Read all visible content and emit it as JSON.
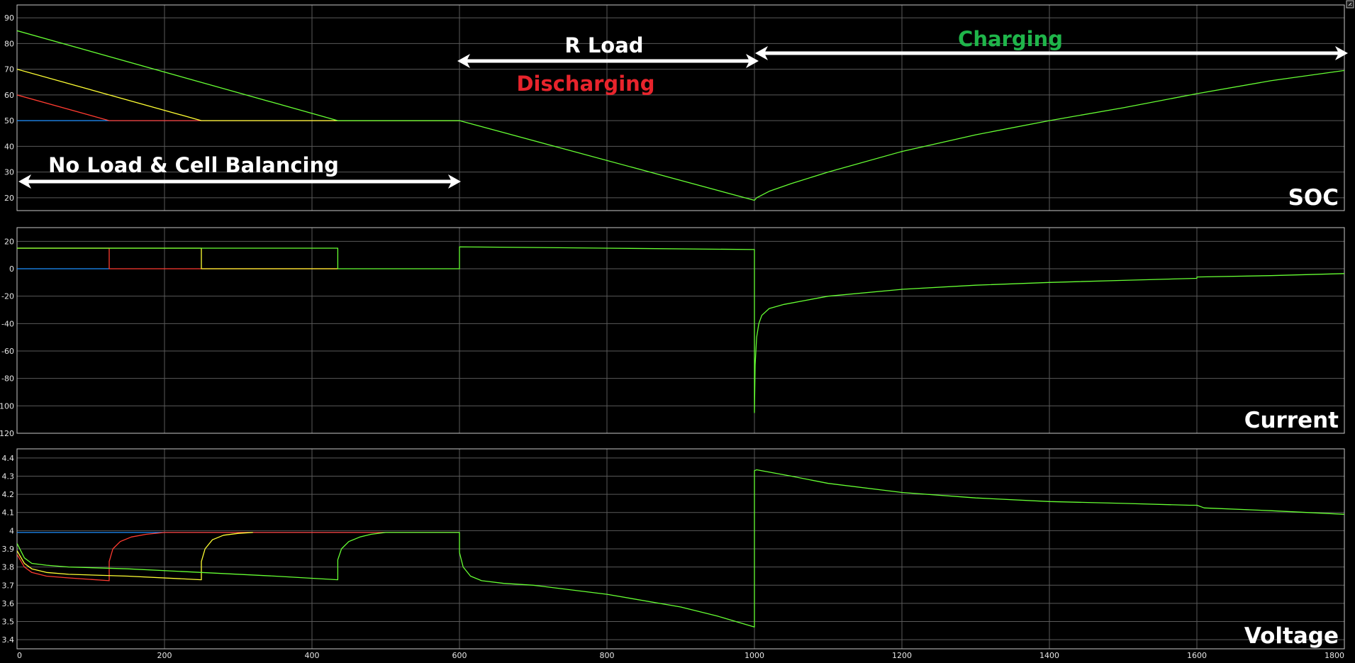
{
  "scope": {
    "background": "#000000",
    "axes_color": "#c8c8c8",
    "grid_color": "#5a5a5a",
    "text_color": "#ffffff",
    "corner_icon": "resize-handle-icon"
  },
  "chart_data": [
    {
      "type": "line",
      "panel_label": "SOC",
      "xlim": [
        0,
        1800
      ],
      "ylim": [
        15,
        95
      ],
      "yticks": [
        20,
        30,
        40,
        50,
        60,
        70,
        80,
        90
      ],
      "xticks": [
        0,
        200,
        400,
        600,
        800,
        1000,
        1200,
        1400,
        1600,
        1800
      ],
      "show_xtick_labels": false,
      "grid": true,
      "series": [
        {
          "color": "#1e90ff",
          "x": [
            0,
            600
          ],
          "y": [
            50,
            50
          ]
        },
        {
          "color": "#ff3b30",
          "x": [
            0,
            125,
            600
          ],
          "y": [
            60,
            50,
            50
          ]
        },
        {
          "color": "#ffff33",
          "x": [
            0,
            250,
            600
          ],
          "y": [
            70,
            50,
            50
          ]
        },
        {
          "color": "#66ff33",
          "x": [
            0,
            435,
            600,
            1000,
            1003,
            1020,
            1050,
            1100,
            1200,
            1300,
            1400,
            1500,
            1600,
            1700,
            1800
          ],
          "y": [
            85,
            50,
            50,
            19,
            20,
            22.5,
            25.5,
            30,
            38,
            44.5,
            50,
            55,
            60.5,
            65.5,
            69.5
          ]
        }
      ],
      "annotations": [
        {
          "text": "No Load & Cell Balancing",
          "color": "#ffffff",
          "arrow_from_x": 0,
          "arrow_to_x": 600,
          "y": 21
        },
        {
          "text": "R Load",
          "color": "#ffffff",
          "arrow_from_x": 600,
          "arrow_to_x": 1000,
          "y": 71
        },
        {
          "text": "Discharging",
          "color": "#e8242c"
        },
        {
          "text": "Charging",
          "color": "#1fb54a",
          "arrow_from_x": 1000,
          "arrow_to_x": 1800,
          "y": 74
        }
      ]
    },
    {
      "type": "line",
      "panel_label": "Current",
      "xlim": [
        0,
        1800
      ],
      "ylim": [
        -120,
        30
      ],
      "yticks": [
        20,
        0,
        -20,
        -40,
        -60,
        -80,
        -100,
        -120
      ],
      "xticks": [
        0,
        200,
        400,
        600,
        800,
        1000,
        1200,
        1400,
        1600,
        1800
      ],
      "show_xtick_labels": false,
      "grid": true,
      "series": [
        {
          "color": "#1e90ff",
          "x": [
            0,
            125
          ],
          "y": [
            0,
            0
          ]
        },
        {
          "color": "#ff3b30",
          "x": [
            0,
            125,
            125,
            435
          ],
          "y": [
            15,
            15,
            0,
            0
          ]
        },
        {
          "color": "#ffff33",
          "x": [
            0,
            210,
            250,
            250,
            435
          ],
          "y": [
            15,
            15,
            15,
            0,
            0
          ]
        },
        {
          "color": "#66ff33",
          "x": [
            0,
            435,
            435,
            600,
            600,
            800,
            1000,
            1000,
            1001,
            1003,
            1006,
            1010,
            1020,
            1040,
            1070,
            1100,
            1200,
            1300,
            1400,
            1500,
            1600,
            1600,
            1700,
            1800
          ],
          "y": [
            15,
            15,
            0,
            0,
            16,
            15,
            14,
            -105,
            -70,
            -50,
            -40,
            -34,
            -29,
            -26,
            -23,
            -20,
            -15,
            -12,
            -10,
            -8.5,
            -7,
            -6,
            -5,
            -3.5
          ]
        }
      ]
    },
    {
      "type": "line",
      "panel_label": "Voltage",
      "xlim": [
        0,
        1800
      ],
      "ylim": [
        3.35,
        4.45
      ],
      "yticks": [
        3.4,
        3.5,
        3.6,
        3.7,
        3.8,
        3.9,
        4,
        4.1,
        4.2,
        4.3,
        4.4
      ],
      "xticks": [
        0,
        200,
        400,
        600,
        800,
        1000,
        1200,
        1400,
        1600,
        1800
      ],
      "show_xtick_labels": true,
      "grid": true,
      "series": [
        {
          "color": "#1e90ff",
          "x": [
            0,
            600
          ],
          "y": [
            3.99,
            3.99
          ]
        },
        {
          "color": "#ff3b30",
          "x": [
            0,
            10,
            20,
            40,
            70,
            125,
            125,
            130,
            140,
            155,
            175,
            200,
            600
          ],
          "y": [
            3.87,
            3.8,
            3.77,
            3.75,
            3.74,
            3.725,
            3.83,
            3.9,
            3.94,
            3.965,
            3.98,
            3.99,
            3.99
          ]
        },
        {
          "color": "#ffff33",
          "x": [
            0,
            10,
            20,
            40,
            70,
            150,
            250,
            250,
            255,
            265,
            280,
            300,
            320
          ],
          "y": [
            3.89,
            3.82,
            3.79,
            3.77,
            3.76,
            3.75,
            3.73,
            3.83,
            3.9,
            3.95,
            3.975,
            3.985,
            3.99
          ]
        },
        {
          "color": "#66ff33",
          "x": [
            0,
            10,
            20,
            40,
            70,
            150,
            250,
            350,
            435,
            435,
            440,
            450,
            465,
            480,
            500,
            600,
            600,
            605,
            615,
            630,
            660,
            700,
            800,
            900,
            950,
            1000,
            1000,
            1003,
            1050,
            1100,
            1200,
            1300,
            1400,
            1500,
            1590,
            1600,
            1610,
            1700,
            1800
          ],
          "y": [
            3.93,
            3.85,
            3.82,
            3.81,
            3.8,
            3.79,
            3.77,
            3.75,
            3.73,
            3.84,
            3.9,
            3.94,
            3.965,
            3.98,
            3.99,
            3.99,
            3.88,
            3.8,
            3.75,
            3.725,
            3.71,
            3.7,
            3.65,
            3.58,
            3.53,
            3.47,
            4.33,
            4.335,
            4.3,
            4.26,
            4.21,
            4.18,
            4.16,
            4.15,
            4.14,
            4.14,
            4.125,
            4.11,
            4.09
          ]
        }
      ]
    }
  ]
}
